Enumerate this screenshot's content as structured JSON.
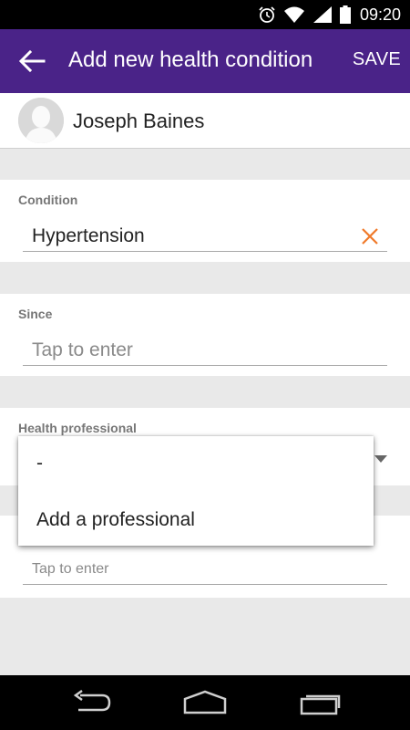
{
  "status_bar": {
    "time": "09:20",
    "icons": [
      "alarm-icon",
      "wifi-icon",
      "signal-icon",
      "battery-icon"
    ]
  },
  "app_bar": {
    "title": "Add new health condition",
    "save_label": "SAVE",
    "background": "#4a2388"
  },
  "patient": {
    "name": "Joseph Baines"
  },
  "condition": {
    "label": "Condition",
    "value": "Hypertension",
    "clear_color": "#f07a2a"
  },
  "since": {
    "label": "Since",
    "placeholder": "Tap to enter"
  },
  "health_professional": {
    "label": "Health professional",
    "options": [
      "-",
      "Add a professional"
    ]
  },
  "next_field": {
    "placeholder": "Tap to enter"
  },
  "nav_bar": {
    "icons": [
      "back-nav-icon",
      "home-nav-icon",
      "recents-nav-icon"
    ]
  }
}
